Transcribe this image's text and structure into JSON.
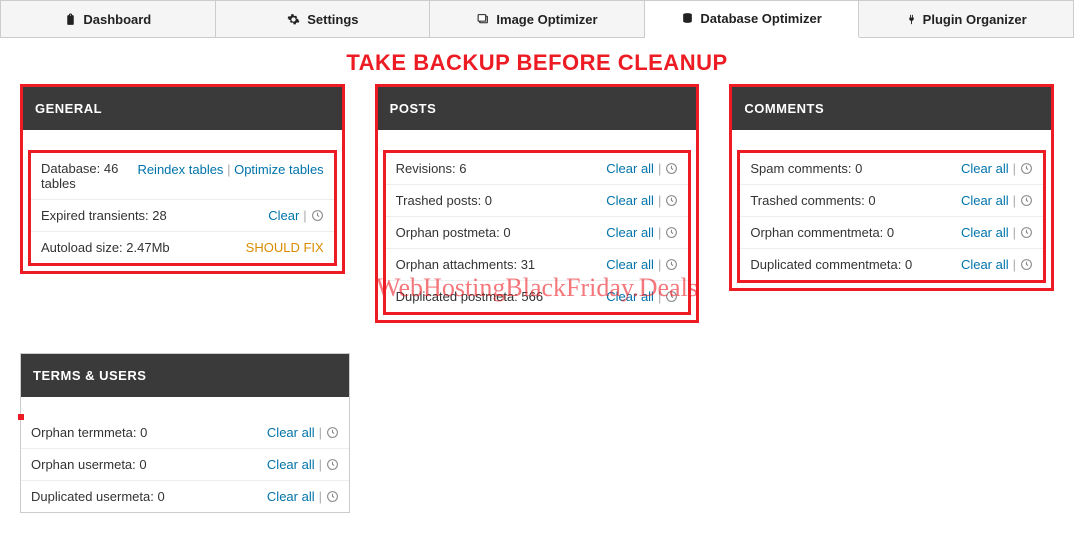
{
  "tabs": {
    "dashboard": "Dashboard",
    "settings": "Settings",
    "image_optimizer": "Image Optimizer",
    "database_optimizer": "Database Optimizer",
    "plugin_organizer": "Plugin Organizer"
  },
  "banner": "TAKE BACKUP BEFORE CLEANUP",
  "watermark": "WebHostingBlackFriday.Deals",
  "general": {
    "title": "GENERAL",
    "database_label": "Database:",
    "database_value": "46 tables",
    "reindex_link": "Reindex tables",
    "optimize_link": "Optimize tables",
    "transients_label": "Expired transients:",
    "transients_value": "28",
    "clear_link": "Clear",
    "autoload_label": "Autoload size:",
    "autoload_value": "2.47Mb",
    "autoload_warn": "SHOULD FIX"
  },
  "posts": {
    "title": "POSTS",
    "clear_all": "Clear all",
    "rows": [
      {
        "label": "Revisions:",
        "value": "6"
      },
      {
        "label": "Trashed posts:",
        "value": "0"
      },
      {
        "label": "Orphan postmeta:",
        "value": "0"
      },
      {
        "label": "Orphan attachments:",
        "value": "31"
      },
      {
        "label": "Duplicated postmeta:",
        "value": "566"
      }
    ]
  },
  "comments": {
    "title": "COMMENTS",
    "clear_all": "Clear all",
    "rows": [
      {
        "label": "Spam comments:",
        "value": "0"
      },
      {
        "label": "Trashed comments:",
        "value": "0"
      },
      {
        "label": "Orphan commentmeta:",
        "value": "0"
      },
      {
        "label": "Duplicated commentmeta:",
        "value": "0"
      }
    ]
  },
  "terms": {
    "title": "TERMS & USERS",
    "clear_all": "Clear all",
    "rows": [
      {
        "label": "Orphan termmeta:",
        "value": "0"
      },
      {
        "label": "Orphan usermeta:",
        "value": "0"
      },
      {
        "label": "Duplicated usermeta:",
        "value": "0"
      }
    ]
  }
}
